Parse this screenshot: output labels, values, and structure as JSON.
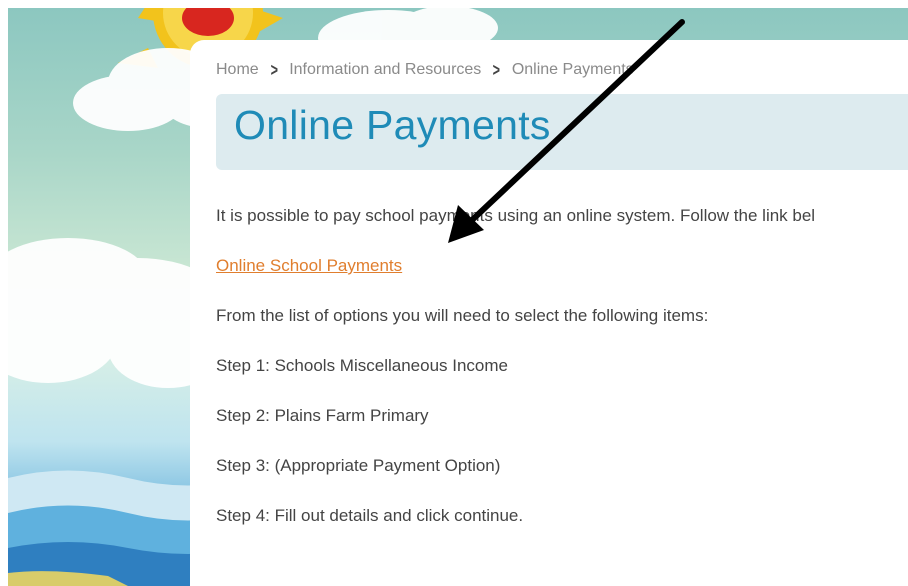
{
  "breadcrumb": {
    "items": [
      "Home",
      "Information and Resources",
      "Online Payments"
    ]
  },
  "page": {
    "title": "Online Payments",
    "intro": "It is possible to pay school payments using an online system. Follow the link bel",
    "link_text": "Online School Payments",
    "instructions": "From the list of options you will need to select the following items:",
    "steps": [
      "Step 1: Schools Miscellaneous Income",
      "Step 2: Plains Farm Primary",
      "Step 3: (Appropriate Payment Option)",
      "Step 4: Fill out details and click continue."
    ]
  },
  "colors": {
    "title": "#1f8bb7",
    "link": "#e07e2e",
    "title_box": "#ddebef",
    "text": "#444444"
  },
  "icons": [
    "sun-icon",
    "chevron-right-icon",
    "pointer-arrow-icon"
  ]
}
